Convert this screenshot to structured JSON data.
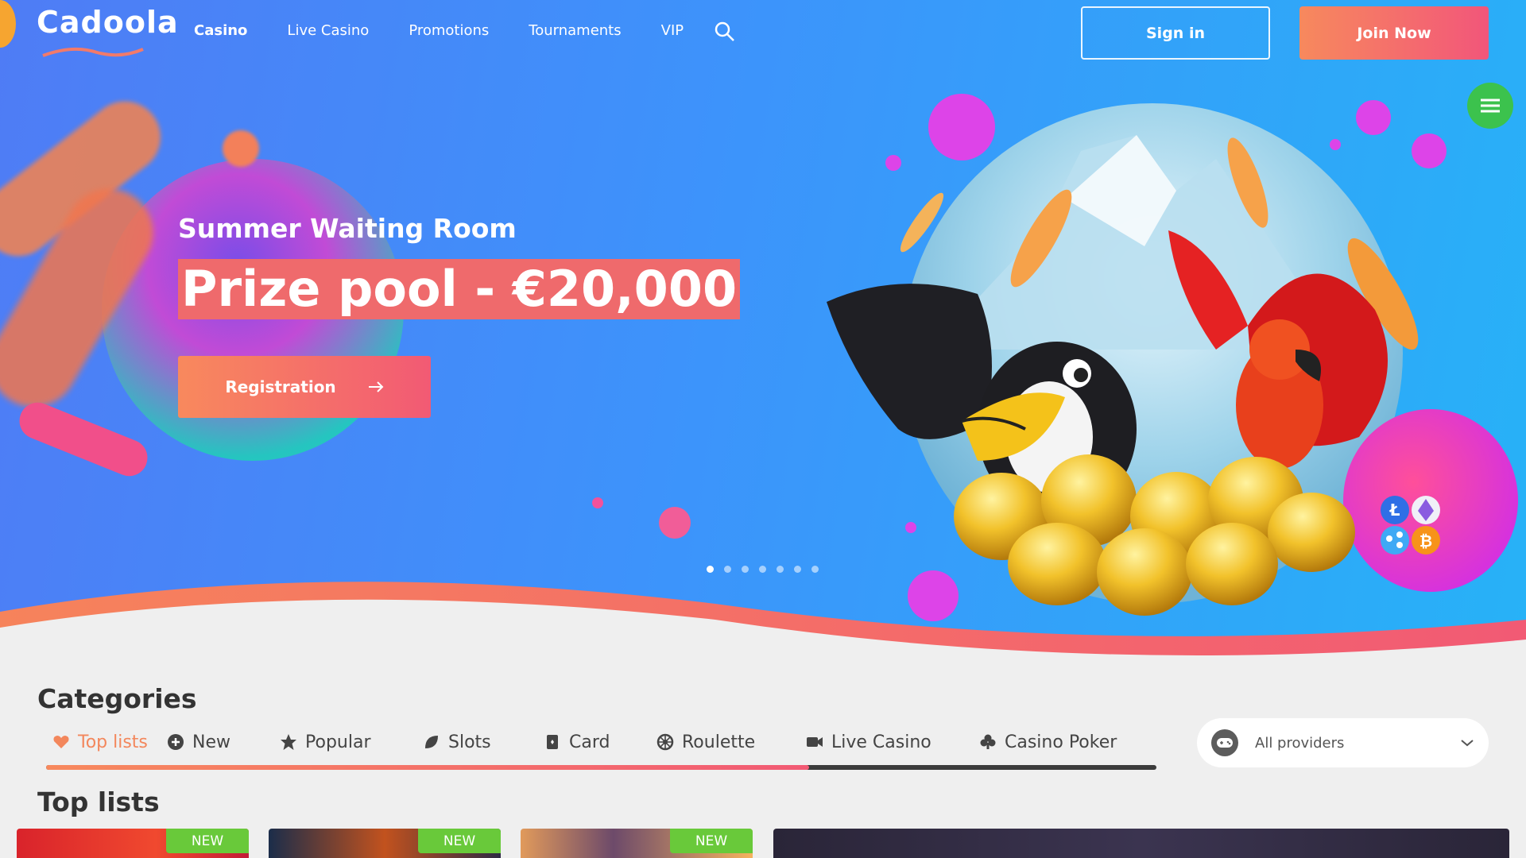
{
  "brand": {
    "name": "Cadoola",
    "accent": "#f25a74",
    "accent2": "#f7895d",
    "hero_blue": "#3d93fb"
  },
  "nav": {
    "items": [
      {
        "label": "Casino",
        "active": true
      },
      {
        "label": "Live Casino"
      },
      {
        "label": "Promotions"
      },
      {
        "label": "Tournaments"
      },
      {
        "label": "VIP"
      }
    ],
    "search_icon": "search-icon"
  },
  "auth": {
    "signin_label": "Sign in",
    "join_label": "Join Now"
  },
  "chat": {
    "icon": "chat-icon"
  },
  "hero": {
    "subtitle": "Summer Waiting Room",
    "title": "Prize pool - €20,000",
    "cta_label": "Registration",
    "slides_total": 7,
    "slide_active": 1,
    "crypto_icons": [
      "litecoin-icon",
      "ethereum-icon",
      "ripple-icon",
      "bitcoin-icon"
    ]
  },
  "categories": {
    "heading": "Categories",
    "tabs": [
      {
        "label": "Top lists",
        "icon": "heart-icon",
        "active": true
      },
      {
        "label": "New",
        "icon": "plus-icon"
      },
      {
        "label": "Popular",
        "icon": "star-icon"
      },
      {
        "label": "Slots",
        "icon": "leaf-icon"
      },
      {
        "label": "Card",
        "icon": "card-icon"
      },
      {
        "label": "Roulette",
        "icon": "roulette-icon"
      },
      {
        "label": "Live Casino",
        "icon": "camera-icon"
      },
      {
        "label": "Casino Poker",
        "icon": "club-icon"
      }
    ],
    "providers_label": "All providers"
  },
  "top_lists": {
    "heading": "Top lists",
    "games": [
      {
        "badge": "NEW"
      },
      {
        "badge": "NEW"
      },
      {
        "badge": "NEW"
      },
      {
        "badge": ""
      }
    ]
  }
}
